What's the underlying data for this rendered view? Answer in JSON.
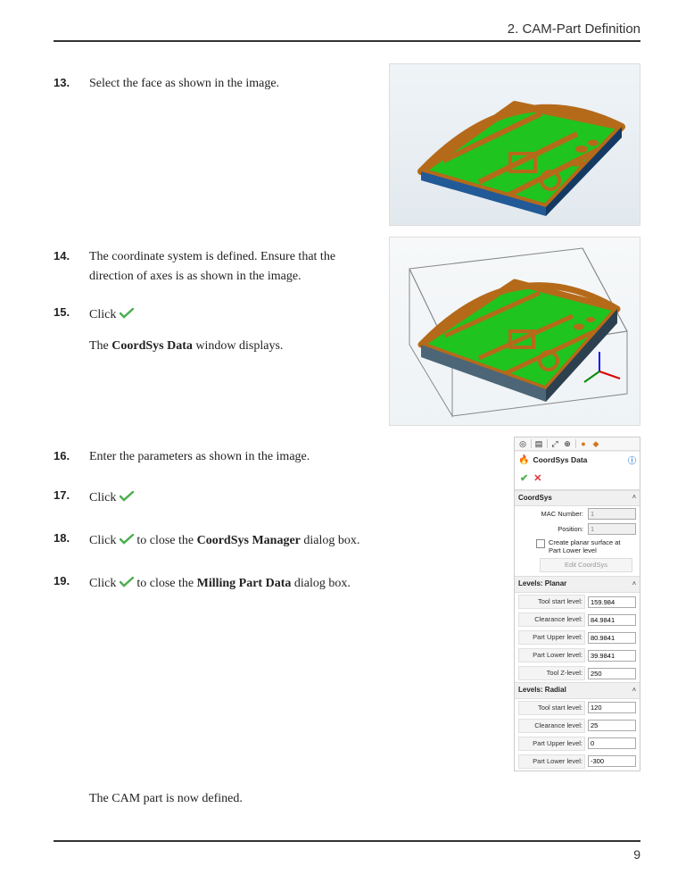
{
  "header": {
    "chapter": "2. CAM-Part Definition"
  },
  "steps": {
    "s13": {
      "num": "13.",
      "text": "Select the face as shown in the image."
    },
    "s14": {
      "num": "14.",
      "text": "The coordinate system is defined. Ensure that the direction of axes is as shown in the image."
    },
    "s15": {
      "num": "15.",
      "text": "Click"
    },
    "s15_after": {
      "prefix": "The ",
      "bold": "CoordSys Data",
      "suffix": " window displays."
    },
    "s16": {
      "num": "16.",
      "text": "Enter the parameters as shown in the image."
    },
    "s17": {
      "num": "17.",
      "text": "Click"
    },
    "s18": {
      "num": "18.",
      "text_before": "Click",
      "text_mid": " to close the ",
      "bold": "CoordSys Manager",
      "text_after": " dialog box."
    },
    "s19": {
      "num": "19.",
      "text_before": "Click",
      "text_mid": " to close the ",
      "bold": "Milling Part Data",
      "text_after": " dialog box."
    }
  },
  "final": "The CAM part is now defined.",
  "page_number": "9",
  "dialog": {
    "title": "CoordSys Data",
    "sections": {
      "coordsys": {
        "title": "CoordSys",
        "mac_number_label": "MAC Number:",
        "mac_number_value": "1",
        "position_label": "Position:",
        "position_value": "1",
        "checkbox_label": "Create planar surface at Part Lower level",
        "edit_btn": "Edit CoordSys"
      },
      "planar": {
        "title": "Levels: Planar",
        "fields": [
          {
            "label": "Tool start level:",
            "value": "159.984"
          },
          {
            "label": "Clearance level:",
            "value": "84.9841"
          },
          {
            "label": "Part Upper level:",
            "value": "80.9841"
          },
          {
            "label": "Part Lower level:",
            "value": "39.9841"
          },
          {
            "label": "Tool Z-level:",
            "value": "250"
          }
        ]
      },
      "radial": {
        "title": "Levels: Radial",
        "fields": [
          {
            "label": "Tool start level:",
            "value": "120"
          },
          {
            "label": "Clearance level:",
            "value": "25"
          },
          {
            "label": "Part Upper level:",
            "value": "0"
          },
          {
            "label": "Part Lower level:",
            "value": "-300"
          }
        ]
      }
    }
  }
}
